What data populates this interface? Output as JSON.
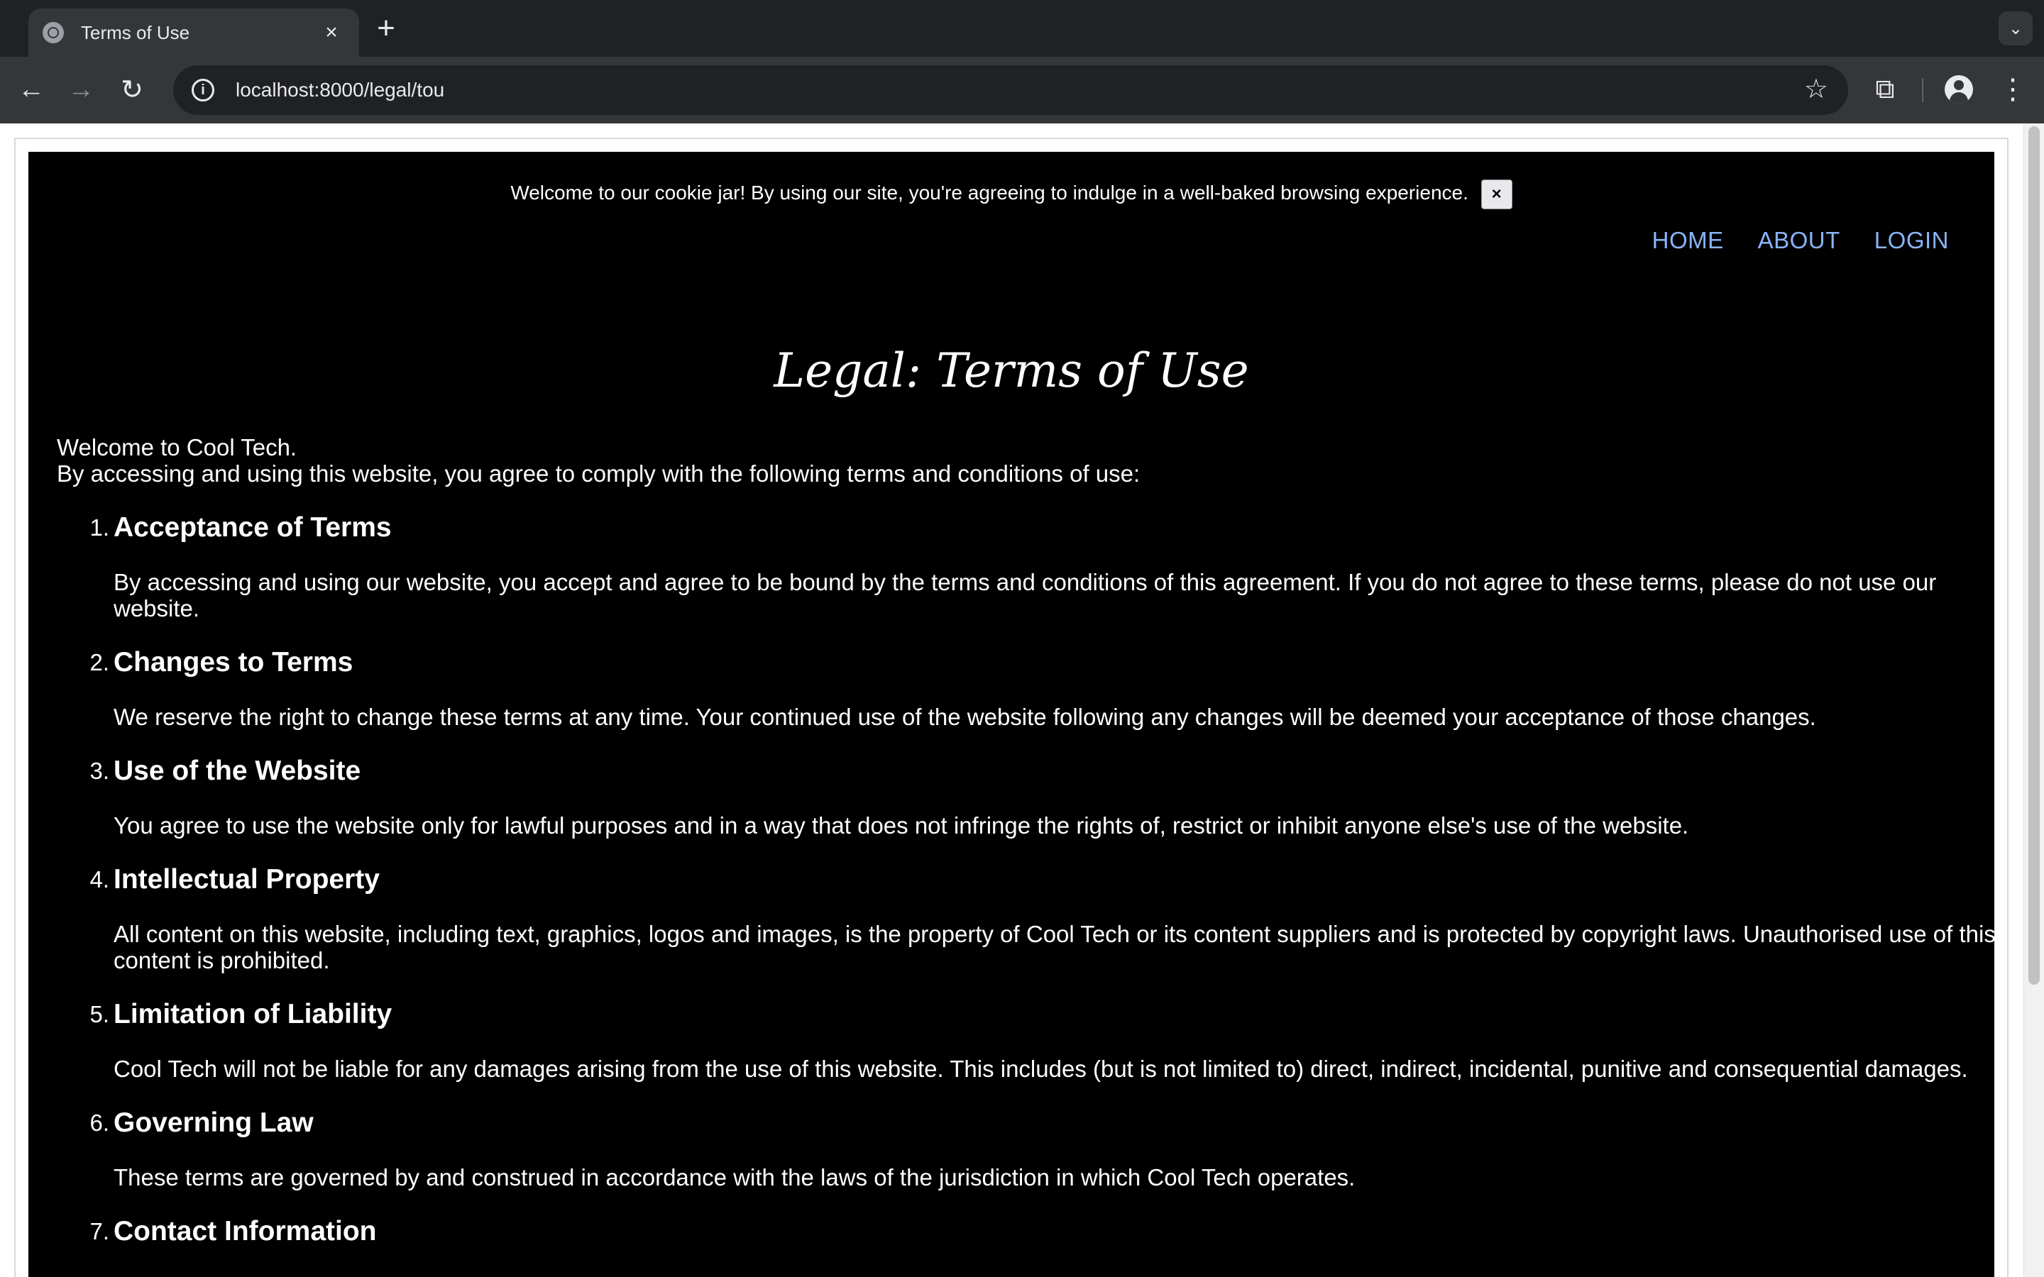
{
  "browser": {
    "tab_title": "Terms of Use",
    "tab_close": "×",
    "new_tab": "+",
    "url": "localhost:8000/legal/tou",
    "site_info": "i"
  },
  "cookie_banner": {
    "text": "Welcome to our cookie jar! By using our site, you're agreeing to indulge in a well-baked browsing experience.",
    "close_label": "×"
  },
  "nav": {
    "home": "HOME",
    "about": "ABOUT",
    "login": "LOGIN"
  },
  "page": {
    "title": "Legal: Terms of Use",
    "intro_line1": "Welcome to Cool Tech.",
    "intro_line2": "By accessing and using this website, you agree to comply with the following terms and conditions of use:"
  },
  "terms": [
    {
      "num": "1.",
      "heading": "Acceptance of Terms",
      "body": "By accessing and using our website, you accept and agree to be bound by the terms and conditions of this agreement. If you do not agree to these terms, please do not use our website."
    },
    {
      "num": "2.",
      "heading": "Changes to Terms",
      "body": "We reserve the right to change these terms at any time. Your continued use of the website following any changes will be deemed your acceptance of those changes."
    },
    {
      "num": "3.",
      "heading": "Use of the Website",
      "body": "You agree to use the website only for lawful purposes and in a way that does not infringe the rights of, restrict or inhibit anyone else's use of the website."
    },
    {
      "num": "4.",
      "heading": "Intellectual Property",
      "body": "All content on this website, including text, graphics, logos and images, is the property of Cool Tech or its content suppliers and is protected by copyright laws. Unauthorised use of this content is prohibited."
    },
    {
      "num": "5.",
      "heading": "Limitation of Liability",
      "body": "Cool Tech will not be liable for any damages arising from the use of this website. This includes (but is not limited to) direct, indirect, incidental, punitive and consequential damages."
    },
    {
      "num": "6.",
      "heading": "Governing Law",
      "body": "These terms are governed by and construed in accordance with the laws of the jurisdiction in which Cool Tech operates."
    },
    {
      "num": "7.",
      "heading": "Contact Information",
      "body": ""
    }
  ]
}
